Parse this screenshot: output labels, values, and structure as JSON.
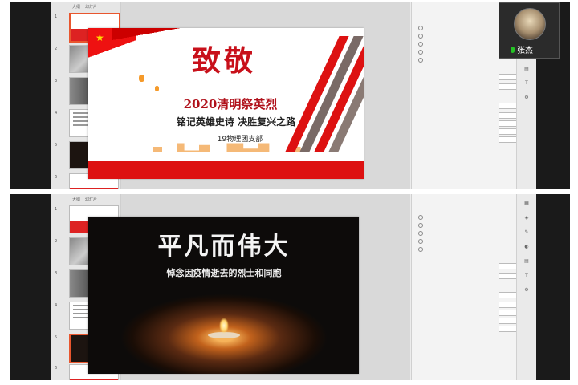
{
  "top_pane": {
    "thumb_tabs": [
      "大纲",
      "幻灯片"
    ],
    "slide_numbers": [
      "1",
      "2",
      "3",
      "4",
      "5",
      "6"
    ],
    "slide": {
      "title": "致敬",
      "subtitle": "2020清明祭英烈",
      "tagline": "铭记英雄史诗  决胜复兴之路",
      "org": "19物理团支部"
    }
  },
  "bottom_pane": {
    "thumb_tabs": [
      "大纲",
      "幻灯片"
    ],
    "slide_numbers": [
      "1",
      "2",
      "3",
      "4",
      "5",
      "6"
    ],
    "slide": {
      "title": "平凡而伟大",
      "subtitle": "悼念因疫情逝去的烈士和同胞"
    }
  },
  "video_call": {
    "name": "张杰"
  },
  "colors": {
    "accent_red": "#c8101a",
    "selection": "#e8562e",
    "mic_green": "#25c225"
  },
  "icons": [
    "flag-icon",
    "mic-icon",
    "side-tool-icon"
  ]
}
